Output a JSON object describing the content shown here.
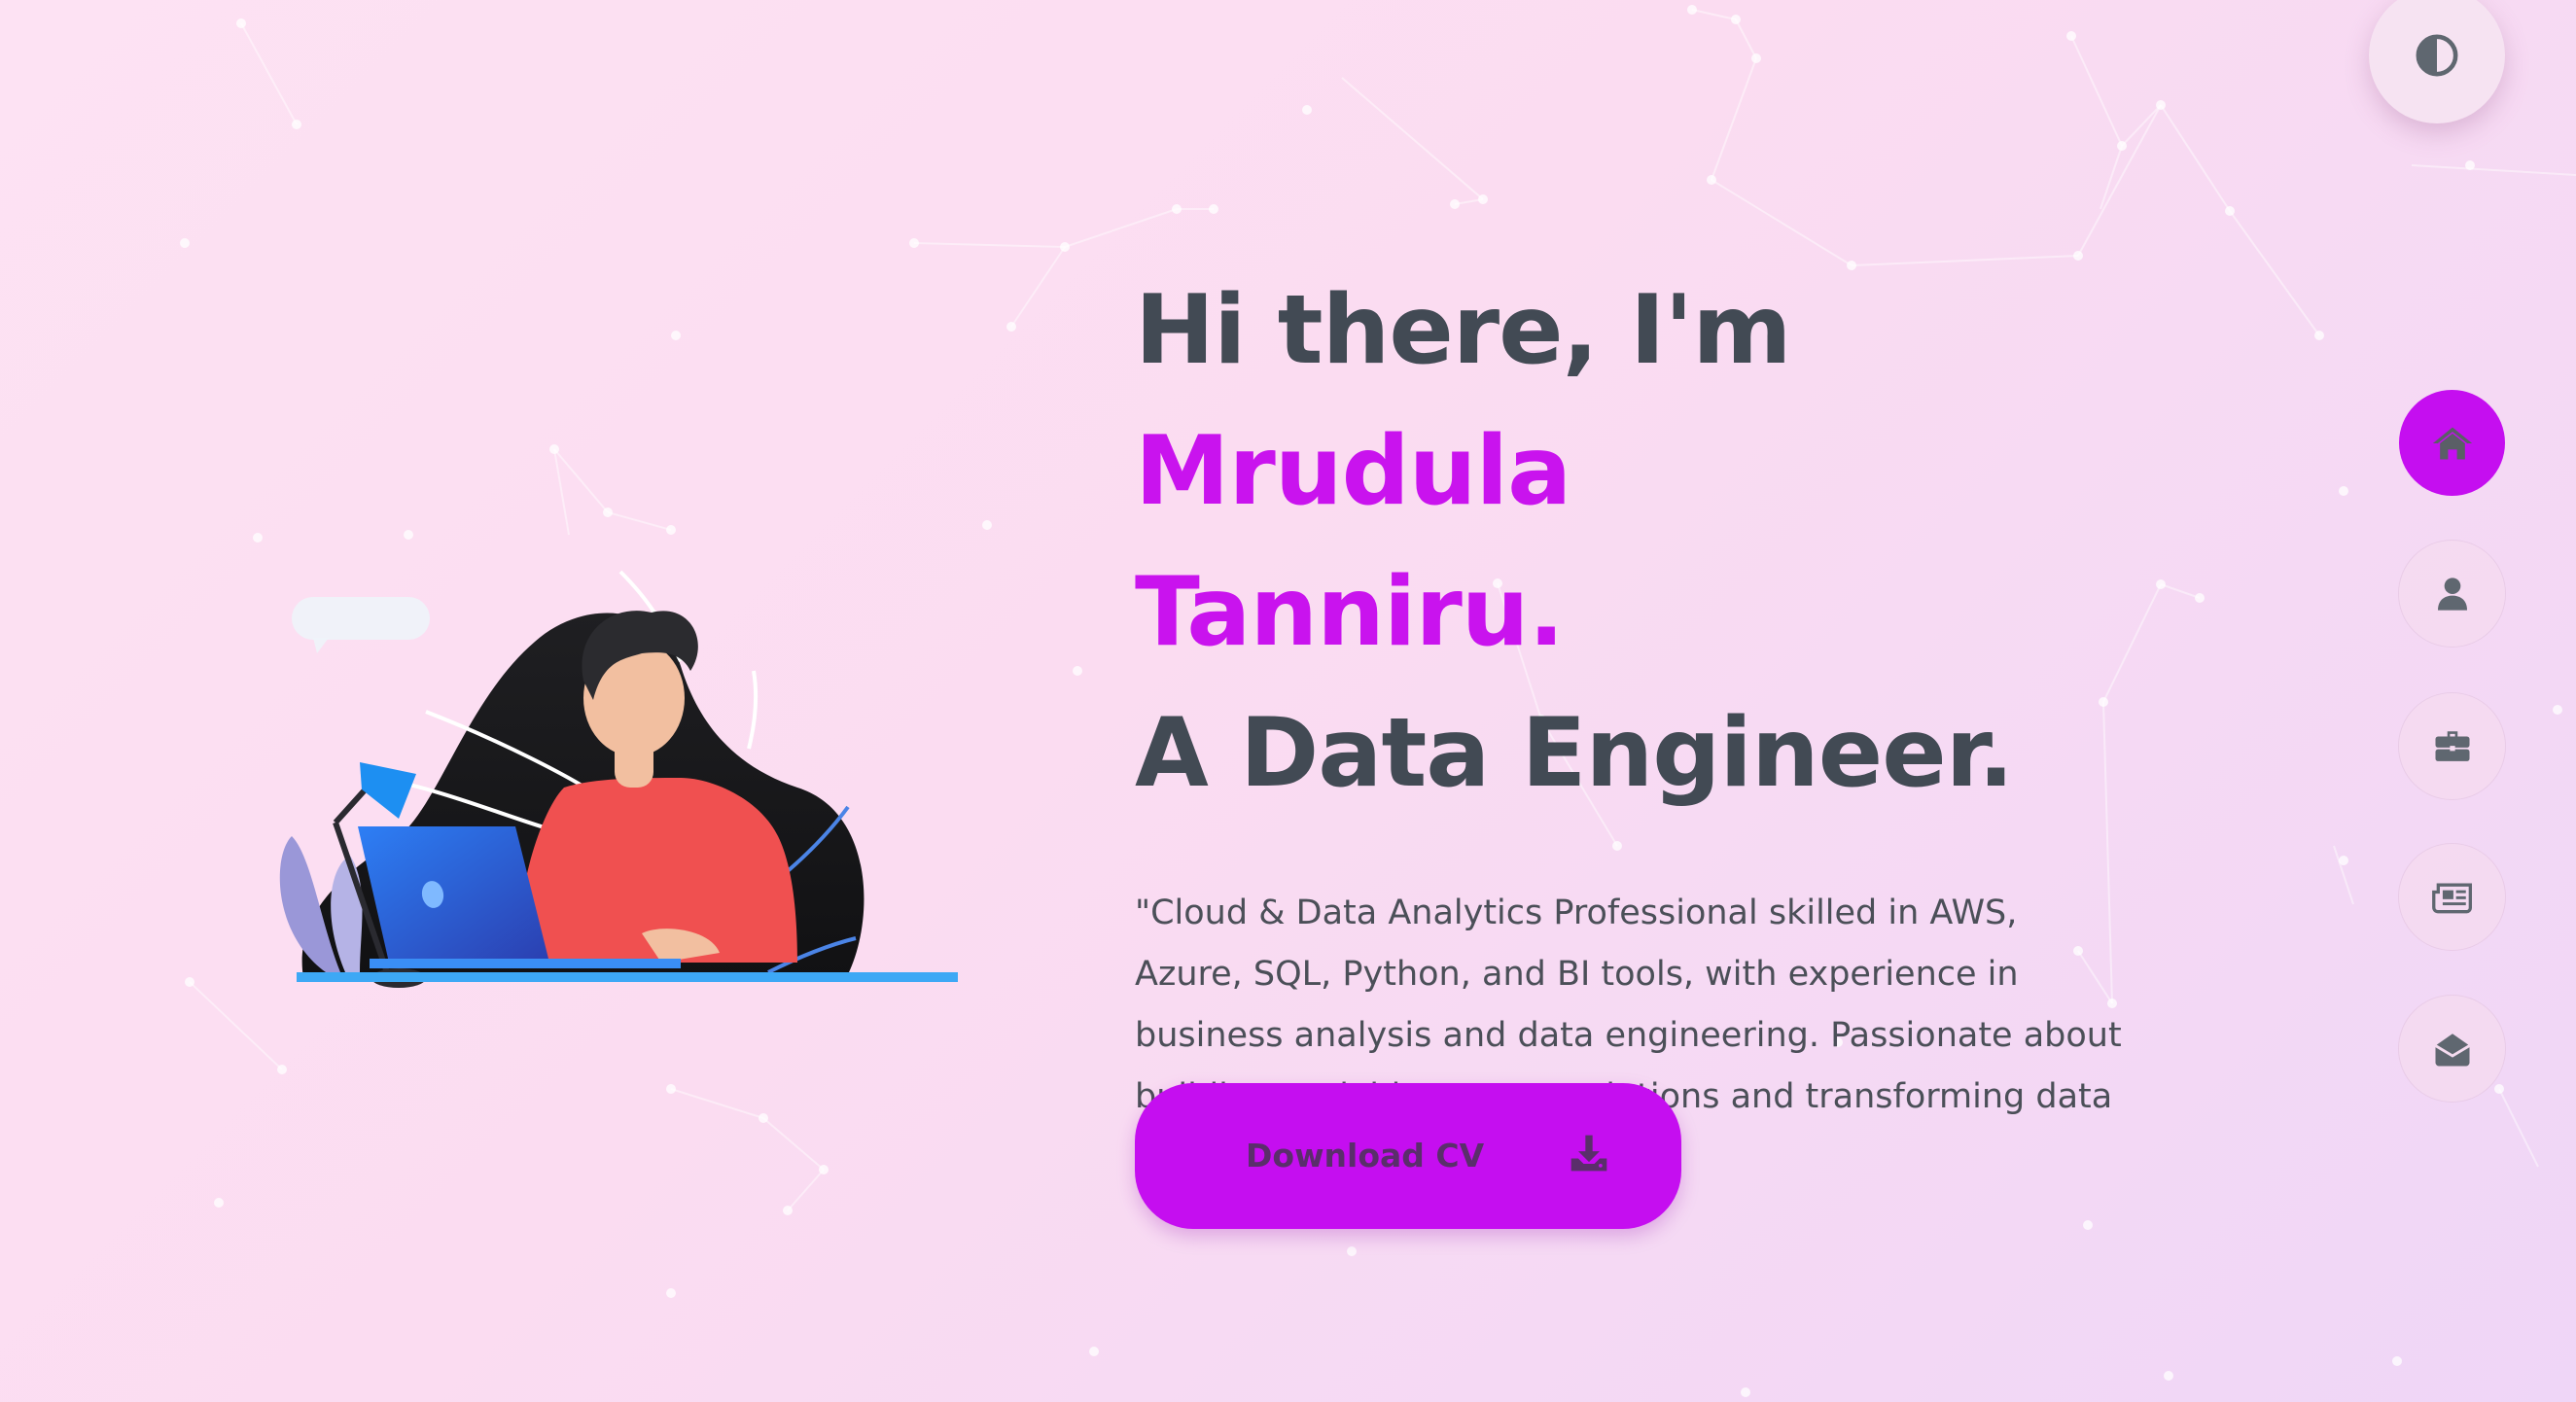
{
  "hero": {
    "greeting": "Hi there, I'm ",
    "name_first": "Mrudula",
    "name_last": "Tanniru.",
    "role": "A Data Engineer.",
    "summary": "\"Cloud & Data Analytics Professional skilled in AWS, Azure, SQL, Python, and BI tools, with experience in business analysis and data engineering. Passionate about building scalable, secure solutions and transforming data into actionable insights.\""
  },
  "download_button": {
    "label": "Download CV",
    "icon": "download-icon"
  },
  "theme_toggle": {
    "icon": "contrast-icon"
  },
  "nav": {
    "items": [
      {
        "name": "home",
        "icon": "home-icon",
        "active": true
      },
      {
        "name": "about",
        "icon": "user-icon",
        "active": false
      },
      {
        "name": "portfolio",
        "icon": "briefcase-icon",
        "active": false
      },
      {
        "name": "blog",
        "icon": "newspaper-icon",
        "active": false
      },
      {
        "name": "contact",
        "icon": "envelope-open-icon",
        "active": false
      }
    ]
  },
  "colors": {
    "accent": "#c50ef0",
    "name": "#c913ee",
    "heading": "#424a54",
    "text": "#4b4f58",
    "background_start": "#fde2f3",
    "background_end": "#efd6f7"
  }
}
